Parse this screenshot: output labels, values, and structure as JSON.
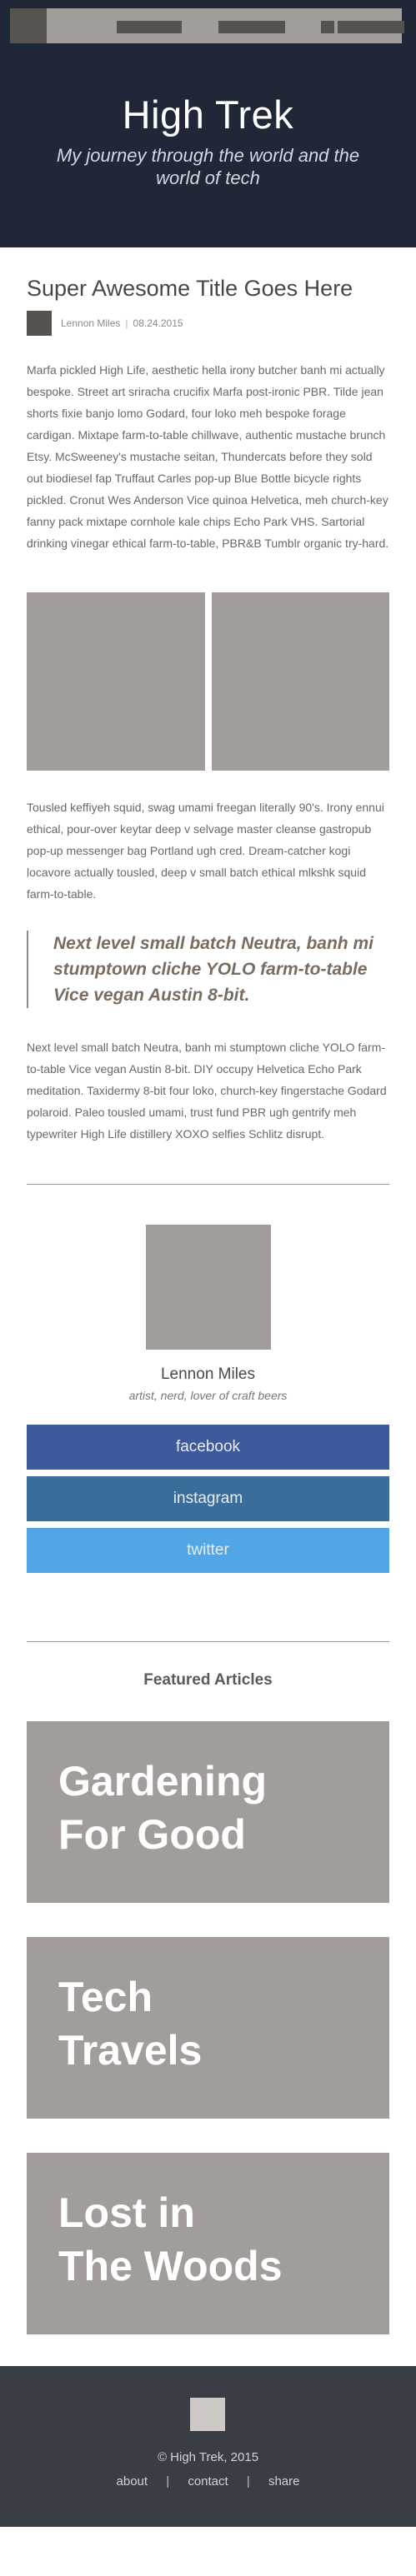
{
  "header": {
    "title": "High Trek",
    "tagline": "My journey through the world and the world of tech"
  },
  "post": {
    "title": "Super Awesome Title Goes Here",
    "author": "Lennon Miles",
    "separator": "|",
    "date": "08.24.2015",
    "paragraph_1": "Marfa pickled High Life, aesthetic hella irony butcher banh mi actually bespoke. Street art sriracha crucifix Marfa post-ironic PBR. Tilde jean shorts fixie banjo lomo Godard, four loko meh bespoke forage cardigan. Mixtape farm-to-table chillwave, authentic mustache brunch Etsy. McSweeney's mustache seitan, Thundercats before they sold out biodiesel fap Truffaut Carles pop-up Blue Bottle bicycle rights pickled. Cronut Wes Anderson Vice quinoa Helvetica, meh church-key fanny pack mixtape cornhole kale chips Echo Park VHS. Sartorial drinking vinegar ethical farm-to-table, PBR&B Tumblr organic try-hard.",
    "paragraph_2": "Tousled keffiyeh squid, swag umami freegan literally 90's. Irony ennui ethical, pour-over keytar deep v selvage master cleanse gastropub pop-up messenger bag Portland ugh cred. Dream-catcher kogi locavore actually tousled, deep v small batch ethical mlkshk squid farm-to-table.",
    "pull_quote": "Next level small batch Neutra, banh mi stumptown cliche YOLO farm-to-table Vice vegan Austin 8-bit.",
    "paragraph_3": "Next level small batch Neutra, banh mi stumptown cliche YOLO farm-to-table Vice vegan Austin 8-bit. DIY occupy Helvetica Echo Park meditation. Taxidermy 8-bit four loko, church-key fingerstache Godard polaroid. Paleo tousled umami, trust fund PBR ugh gentrify meh typewriter High Life distillery XOXO selfies Schlitz disrupt."
  },
  "author_box": {
    "name": "Lennon Miles",
    "bio": "artist, nerd, lover of craft beers",
    "social": [
      {
        "label": "facebook",
        "color": "#3d5a9c"
      },
      {
        "label": "instagram",
        "color": "#3a6e9a"
      },
      {
        "label": "twitter",
        "color": "#53a6e6"
      }
    ]
  },
  "featured": {
    "title": "Featured Articles",
    "articles": [
      {
        "line_1": "Gardening",
        "line_2": "For Good"
      },
      {
        "line_1": "Tech",
        "line_2": "Travels"
      },
      {
        "line_1": "Lost in",
        "line_2": "The Woods"
      }
    ]
  },
  "footer": {
    "copyright": "© High Trek, 2015",
    "links": [
      "about",
      "contact",
      "share"
    ],
    "separator": "|"
  },
  "colors": {
    "header_bg": "#202737",
    "placeholder_gray": "#a29d9a",
    "footer_bg": "#393d46",
    "quote_text": "#7a6d5f"
  }
}
